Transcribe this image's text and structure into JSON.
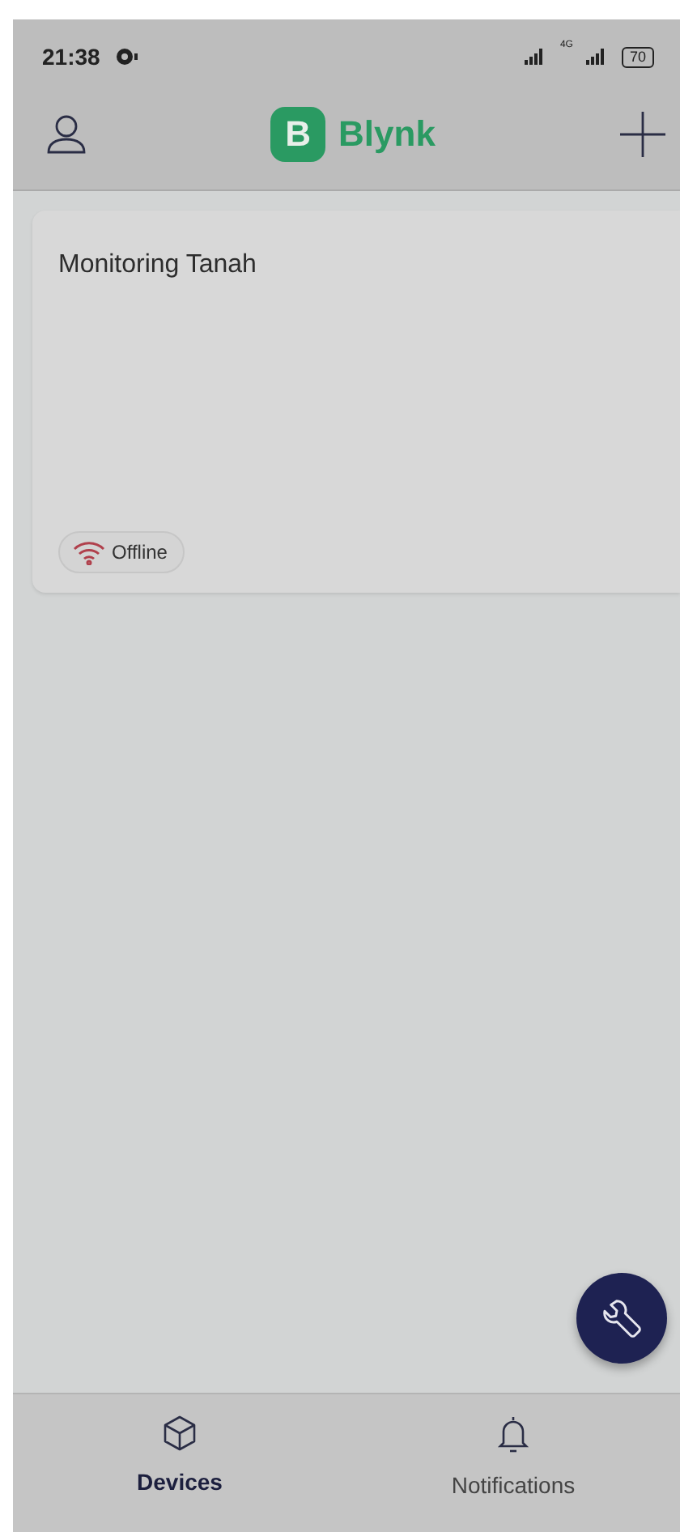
{
  "status_bar": {
    "time": "21:38",
    "network": "4G",
    "battery": "70"
  },
  "header": {
    "logo_letter": "B",
    "title": "Blynk"
  },
  "devices": [
    {
      "name": "Monitoring Tanah",
      "status": "Offline",
      "online": false
    }
  ],
  "nav_tabs": [
    {
      "label": "Devices",
      "kind": "devices",
      "selected": true
    },
    {
      "label": "Notifications",
      "kind": "notifications",
      "selected": false
    }
  ]
}
